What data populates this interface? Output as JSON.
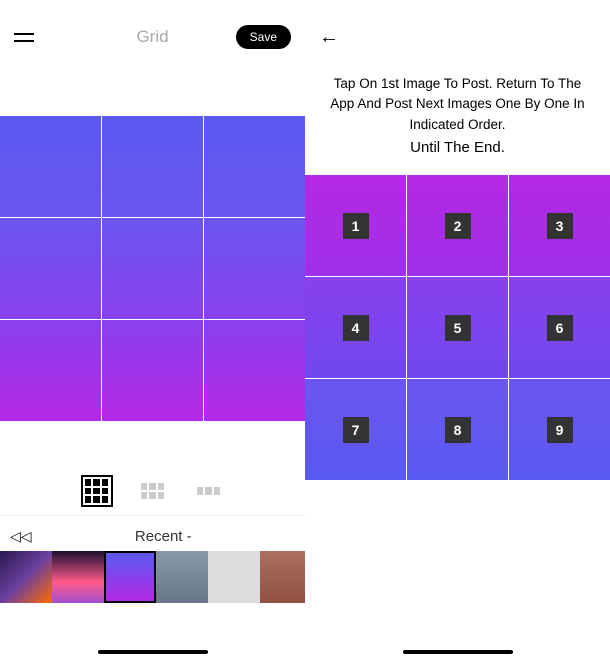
{
  "left": {
    "title": "Grid",
    "save_label": "Save",
    "recent_label": "Recent -",
    "view_modes": [
      "3x3",
      "3x2",
      "3x1"
    ],
    "active_view_mode": "3x3"
  },
  "right": {
    "instruction_line1": "Tap On 1st Image To Post. Return To The App And Post Next Images One By One In Indicated Order.",
    "instruction_line2": "Until The End.",
    "numbers": [
      "1",
      "2",
      "3",
      "4",
      "5",
      "6",
      "7",
      "8",
      "9"
    ]
  },
  "colors": {
    "gradient_top": "#5a5af0",
    "gradient_bottom": "#b428e6",
    "save_bg": "#000000"
  }
}
